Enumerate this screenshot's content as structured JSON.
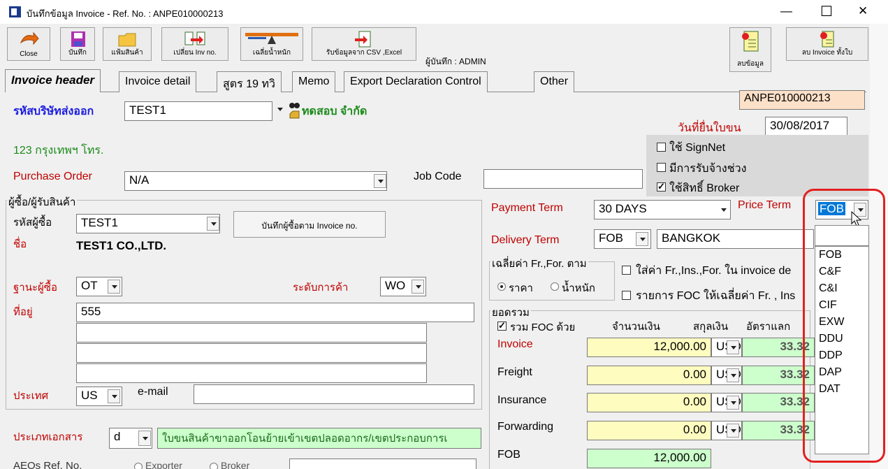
{
  "window": {
    "title": "บันทึกข้อมูล Invoice - Ref. No. : ANPE010000213",
    "min": "—",
    "max": "☐",
    "close": "✕"
  },
  "toolbar": {
    "close": "Close",
    "save": "บันทึก",
    "product_file": "แฟ้มสินค้า",
    "change_inv": "เปลี่ยน Inv no.",
    "avg_weight": "เฉลี่ยน้ำหนัก",
    "import_csv": "รับข้อมูลจาก CSV ,Excel",
    "saved_by": "ผู้บันทึก : ADMIN",
    "delete_data": "ลบข้อมูล",
    "delete_invoice": "ลบ Invoice ทั้งใบ"
  },
  "tabs": [
    "Invoice header",
    "Invoice detail",
    "สูตร 19 ทวิ",
    "Memo",
    "Export Declaration Control",
    "Other"
  ],
  "ref_no": "ANPE010000213",
  "exporter": {
    "label": "รหัสบริษัทส่งออก",
    "code": "TEST1",
    "name": "ทดสอบ จำกัด",
    "address": "123  กรุงเทพฯ โทร."
  },
  "bill_date": {
    "label": "วันที่ยื่นใบขน",
    "value": "30/08/2017"
  },
  "options": {
    "signnet": "ใช้ SignNet",
    "subcontract": "มีการรับจ้างช่วง",
    "broker": "ใช้สิทธิ์ Broker"
  },
  "po": {
    "label": "Purchase Order",
    "value": "N/A"
  },
  "job_code": {
    "label": "Job Code",
    "value": ""
  },
  "buyer": {
    "group_label": "ผู้ซื้อ/ผู้รับสินค้า",
    "code_label": "รหัสผู้ซื้อ",
    "code": "TEST1",
    "save_button": "บันทึกผู้ซื้อตาม Invoice no.",
    "name_label": "ชื่อ",
    "name": "TEST1 CO.,LTD.",
    "status_label": "ฐานะผู้ซื้อ",
    "status": "OT",
    "trade_level_label": "ระดับการค้า",
    "trade_level": "WO",
    "address_label": "ที่อยู่",
    "address": [
      "555",
      "",
      "",
      ""
    ],
    "country_label": "ประเทศ",
    "country": "US",
    "email_label": "e-mail",
    "email": ""
  },
  "doc_type": {
    "label": "ประเภทเอกสาร",
    "value": "d",
    "desc": "ใบขนสินค้าขาออกโอนย้ายเข้าเขตปลอดอากร/เขตประกอบการเ"
  },
  "aeo": {
    "label": "AEOs Ref. No.",
    "opt1": "Exporter",
    "opt2": "Broker"
  },
  "payment_term": {
    "label": "Payment Term",
    "value": "30 DAYS"
  },
  "price_term": {
    "label": "Price Term",
    "value": "FOB"
  },
  "delivery_term": {
    "label": "Delivery Term",
    "value": "FOB",
    "place": "BANGKOK"
  },
  "average": {
    "group_label": "เฉลี่ยค่า Fr.,For. ตาม",
    "opt_price": "ราคา",
    "opt_weight": "น้ำหนัก",
    "check1": "ใส่ค่า Fr.,Ins.,For. ใน invoice de",
    "check2": "รายการ FOC ให้เฉลี่ยค่า Fr. , Ins"
  },
  "totals": {
    "group_label": "ยอดรวม",
    "include_foc": "รวม FOC ด้วย",
    "col_amount": "จำนวนเงิน",
    "col_currency": "สกุลเงิน",
    "col_rate": "อัตราแลก",
    "rows": [
      {
        "label": "Invoice",
        "amount": "12,000.00",
        "currency": "USD",
        "rate": "33.32"
      },
      {
        "label": "Freight",
        "amount": "0.00",
        "currency": "USD",
        "rate": "33.32"
      },
      {
        "label": "Insurance",
        "amount": "0.00",
        "currency": "USD",
        "rate": "33.32"
      },
      {
        "label": "Forwarding",
        "amount": "0.00",
        "currency": "USD",
        "rate": "33.32"
      }
    ],
    "fob_label": "FOB",
    "fob": "12,000.00"
  },
  "price_term_options": [
    "",
    "FOB",
    "C&F",
    "C&I",
    "CIF",
    "EXW",
    "DDU",
    "DDP",
    "DAP",
    "DAT"
  ],
  "colors": {
    "highlight": "#e32020",
    "required_label": "#c00000",
    "blue_label": "#1a1ae0",
    "green_text": "#1a8a1a",
    "selection": "#0078d7"
  }
}
